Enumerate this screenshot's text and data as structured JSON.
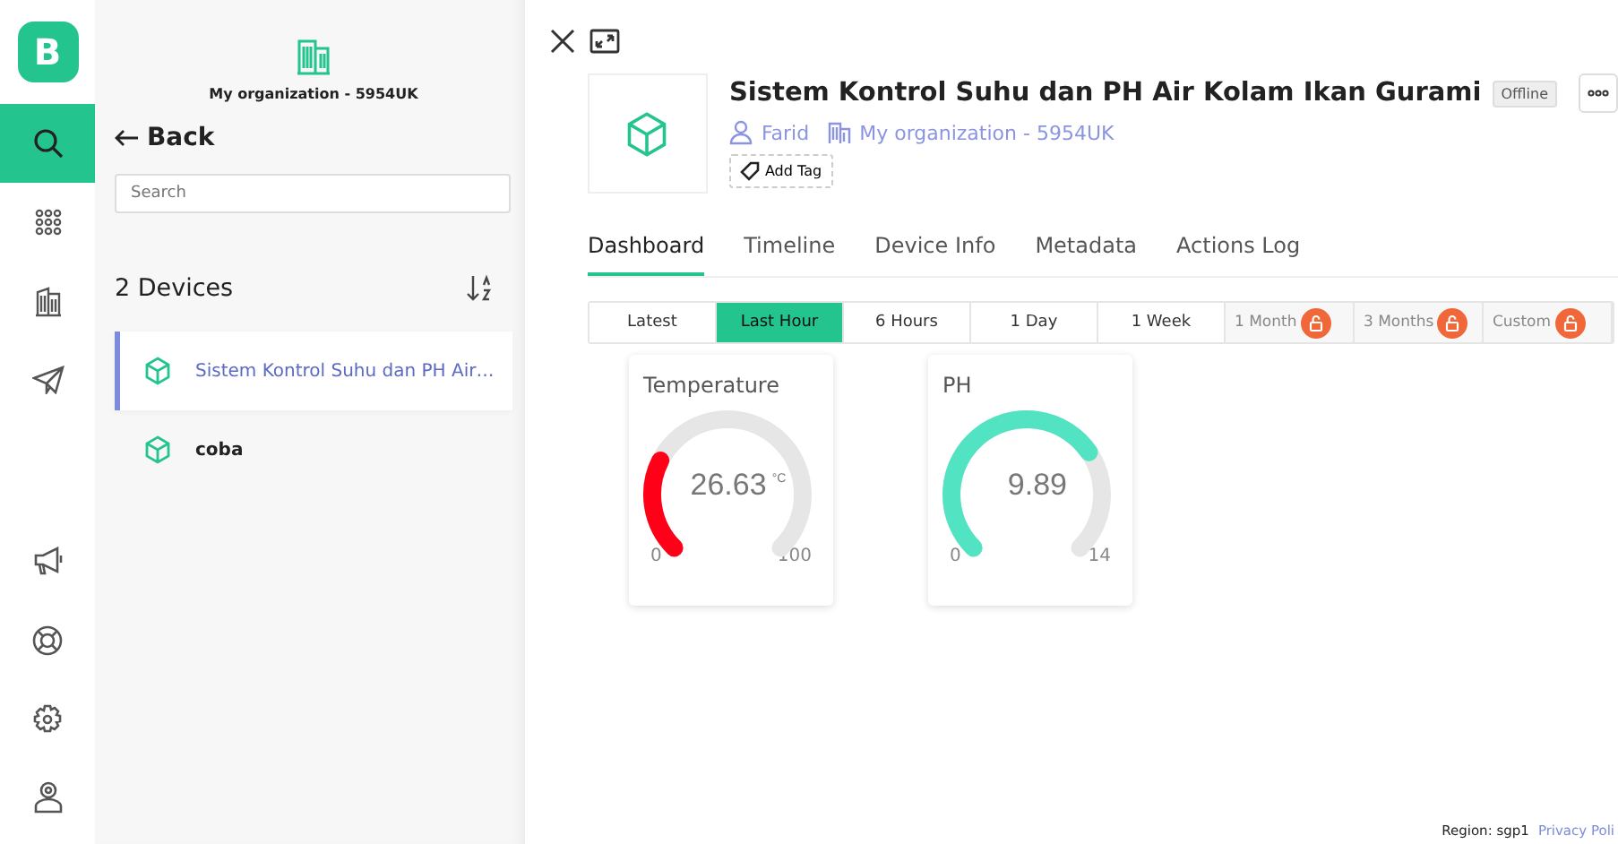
{
  "rail": {
    "logo": "B",
    "items": [
      {
        "kind": "search",
        "selected": true
      },
      {
        "kind": "grid",
        "selected": false
      },
      {
        "kind": "building",
        "selected": false
      },
      {
        "kind": "send",
        "selected": false
      }
    ],
    "bottom": [
      {
        "kind": "megaphone"
      },
      {
        "kind": "lifebuoy"
      },
      {
        "kind": "settings"
      },
      {
        "kind": "user"
      }
    ]
  },
  "sidebar": {
    "organization": "My organization - 5954UK",
    "back": "Back",
    "search": {
      "placeholder": "Search"
    },
    "count": "2 Devices",
    "devices": [
      {
        "name": "Sistem Kontrol Suhu dan PH Air…",
        "selected": true
      },
      {
        "name": "coba",
        "selected": false
      }
    ]
  },
  "device": {
    "title": "Sistem Kontrol Suhu dan PH Air Kolam Ikan Gurami",
    "status": "Offline",
    "owner": "Farid",
    "organization": "My organization - 5954UK",
    "add_tag": "Add Tag"
  },
  "tabs": [
    {
      "label": "Dashboard",
      "selected": true
    },
    {
      "label": "Timeline",
      "selected": false
    },
    {
      "label": "Device Info",
      "selected": false
    },
    {
      "label": "Metadata",
      "selected": false
    },
    {
      "label": "Actions Log",
      "selected": false
    }
  ],
  "ranges": [
    {
      "label": "Latest",
      "selected": false,
      "locked": false
    },
    {
      "label": "Last Hour",
      "selected": true,
      "locked": false
    },
    {
      "label": "6 Hours",
      "selected": false,
      "locked": false
    },
    {
      "label": "1 Day",
      "selected": false,
      "locked": false
    },
    {
      "label": "1 Week",
      "selected": false,
      "locked": false
    },
    {
      "label": "1 Month",
      "selected": false,
      "locked": true
    },
    {
      "label": "3 Months",
      "selected": false,
      "locked": true
    },
    {
      "label": "Custom",
      "selected": false,
      "locked": true
    }
  ],
  "widgets": [
    {
      "title": "Temperature",
      "value": "26.63",
      "unit": "°C",
      "min": "0",
      "max": "100",
      "color": "#ff0019"
    },
    {
      "title": "PH",
      "value": "9.89",
      "min": "0",
      "max": "14",
      "color": "#52e3c2"
    }
  ],
  "footer": {
    "region": "Region: sgp1",
    "privacy": "Privacy Poli"
  }
}
